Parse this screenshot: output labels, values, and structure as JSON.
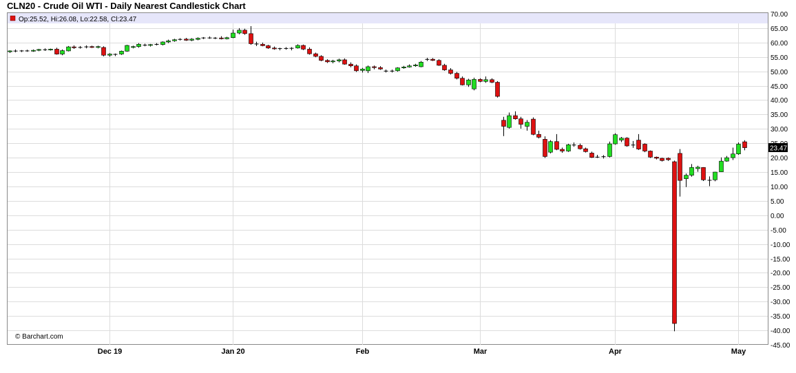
{
  "chart_title": "CLN20 - Crude Oil WTI - Daily Nearest Candlestick Chart",
  "legend": "Op:25.52, Hi:26.08, Lo:22.58, Cl:23.47",
  "credit": "© Barchart.com",
  "last_price_label": "23.47",
  "colors": {
    "up": "#22dd22",
    "down": "#dd1111",
    "legend_band": "#e6e6fa",
    "grid": "#dcdcdc",
    "last_label_bg": "#000000"
  },
  "chart_data": {
    "type": "candlestick",
    "title": "CLN20 - Crude Oil WTI - Daily Nearest Candlestick Chart",
    "y_range": [
      -45,
      70
    ],
    "y_ticks": [
      70,
      65,
      60,
      55,
      50,
      45,
      40,
      35,
      30,
      25,
      20,
      15,
      10,
      5,
      0,
      -5,
      -10,
      -15,
      -20,
      -25,
      -30,
      -35,
      -40,
      -45
    ],
    "y_tick_labels": [
      "70.00",
      "65.00",
      "60.00",
      "55.00",
      "50.00",
      "45.00",
      "40.00",
      "35.00",
      "30.00",
      "25.00",
      "20.00",
      "15.00",
      "10.00",
      "5.00",
      "0.00",
      "-5.00",
      "-10.00",
      "-15.00",
      "-20.00",
      "-25.00",
      "-30.00",
      "-35.00",
      "-40.00",
      "-45.00"
    ],
    "x_labels": [
      {
        "label": "Dec 19",
        "bar": 17
      },
      {
        "label": "Jan 20",
        "bar": 38
      },
      {
        "label": "Feb",
        "bar": 60
      },
      {
        "label": "Mar",
        "bar": 80
      },
      {
        "label": "Apr",
        "bar": 103
      },
      {
        "label": "May",
        "bar": 124
      }
    ],
    "grid": true,
    "ohlc": [
      [
        56.8,
        57.3,
        56.4,
        57.1
      ],
      [
        57.1,
        57.6,
        56.6,
        57.0
      ],
      [
        57.0,
        57.4,
        56.7,
        57.2
      ],
      [
        57.2,
        57.5,
        56.8,
        57.0
      ],
      [
        57.0,
        57.6,
        56.8,
        57.3
      ],
      [
        57.3,
        57.8,
        57.0,
        57.6
      ],
      [
        57.6,
        58.0,
        57.1,
        57.4
      ],
      [
        57.4,
        57.9,
        57.2,
        57.7
      ],
      [
        57.7,
        58.2,
        55.8,
        56.0
      ],
      [
        56.0,
        57.6,
        55.6,
        57.2
      ],
      [
        57.1,
        58.8,
        56.9,
        58.5
      ],
      [
        58.5,
        59.0,
        57.8,
        58.2
      ],
      [
        58.2,
        58.8,
        57.9,
        58.4
      ],
      [
        58.4,
        59.0,
        58.0,
        58.6
      ],
      [
        58.6,
        58.9,
        58.1,
        58.3
      ],
      [
        58.3,
        58.9,
        58.0,
        58.6
      ],
      [
        58.3,
        58.7,
        55.2,
        55.6
      ],
      [
        55.6,
        56.3,
        55.1,
        56.0
      ],
      [
        55.8,
        56.2,
        55.3,
        56.0
      ],
      [
        56.0,
        57.2,
        55.7,
        57.0
      ],
      [
        57.0,
        59.2,
        56.8,
        59.0
      ],
      [
        58.3,
        58.9,
        58.0,
        58.6
      ],
      [
        58.6,
        59.8,
        58.2,
        59.4
      ],
      [
        59.2,
        59.6,
        58.7,
        59.0
      ],
      [
        59.0,
        59.5,
        58.6,
        59.3
      ],
      [
        59.3,
        59.8,
        59.0,
        59.4
      ],
      [
        59.3,
        60.4,
        59.0,
        60.2
      ],
      [
        60.2,
        61.0,
        59.8,
        60.6
      ],
      [
        60.6,
        61.3,
        60.3,
        61.0
      ],
      [
        61.0,
        61.5,
        60.7,
        61.2
      ],
      [
        61.2,
        61.6,
        60.6,
        60.8
      ],
      [
        60.8,
        61.5,
        60.5,
        61.2
      ],
      [
        61.1,
        61.8,
        60.8,
        61.5
      ],
      [
        61.5,
        61.9,
        61.2,
        61.7
      ],
      [
        61.7,
        62.1,
        61.3,
        61.5
      ],
      [
        61.5,
        61.9,
        61.2,
        61.6
      ],
      [
        61.6,
        62.2,
        61.1,
        61.3
      ],
      [
        61.3,
        62.0,
        61.1,
        61.7
      ],
      [
        61.7,
        64.5,
        61.5,
        63.3
      ],
      [
        63.3,
        65.0,
        62.9,
        64.3
      ],
      [
        64.3,
        64.8,
        62.7,
        63.1
      ],
      [
        63.1,
        65.7,
        59.2,
        59.6
      ],
      [
        59.6,
        60.3,
        58.8,
        59.4
      ],
      [
        59.4,
        60.0,
        58.7,
        58.9
      ],
      [
        58.9,
        59.2,
        57.8,
        58.1
      ],
      [
        58.1,
        58.6,
        57.5,
        57.8
      ],
      [
        57.8,
        58.2,
        57.3,
        58.0
      ],
      [
        58.0,
        58.4,
        57.5,
        57.9
      ],
      [
        57.9,
        58.4,
        57.3,
        58.1
      ],
      [
        58.1,
        59.4,
        57.9,
        59.0
      ],
      [
        59.0,
        59.3,
        57.4,
        57.7
      ],
      [
        57.7,
        58.3,
        55.8,
        56.1
      ],
      [
        56.1,
        56.5,
        54.9,
        55.2
      ],
      [
        55.2,
        55.6,
        53.5,
        53.8
      ],
      [
        53.8,
        54.2,
        52.9,
        53.3
      ],
      [
        53.3,
        54.0,
        52.8,
        53.6
      ],
      [
        53.6,
        54.4,
        53.1,
        54.0
      ],
      [
        54.0,
        54.5,
        52.3,
        52.5
      ],
      [
        52.5,
        53.1,
        51.4,
        51.9
      ],
      [
        51.9,
        52.4,
        49.8,
        50.2
      ],
      [
        50.3,
        51.2,
        49.6,
        50.8
      ],
      [
        50.2,
        52.0,
        49.4,
        51.6
      ],
      [
        51.6,
        52.0,
        50.7,
        51.3
      ],
      [
        51.3,
        51.8,
        50.5,
        50.8
      ],
      [
        50.0,
        50.6,
        49.6,
        50.2
      ],
      [
        50.2,
        50.6,
        49.6,
        50.0
      ],
      [
        50.2,
        51.4,
        49.9,
        51.2
      ],
      [
        51.2,
        51.9,
        50.9,
        51.5
      ],
      [
        51.5,
        52.4,
        51.3,
        51.9
      ],
      [
        51.9,
        52.6,
        51.6,
        52.2
      ],
      [
        51.6,
        53.6,
        51.4,
        53.2
      ],
      [
        54.1,
        54.7,
        53.6,
        54.2
      ],
      [
        54.2,
        54.6,
        53.6,
        53.8
      ],
      [
        53.8,
        54.2,
        51.9,
        52.1
      ],
      [
        52.1,
        52.6,
        50.2,
        50.5
      ],
      [
        50.5,
        51.1,
        48.9,
        49.3
      ],
      [
        49.3,
        49.8,
        47.2,
        47.6
      ],
      [
        47.6,
        48.2,
        45.1,
        45.3
      ],
      [
        45.3,
        47.4,
        44.6,
        47.0
      ],
      [
        43.9,
        47.8,
        43.4,
        47.2
      ],
      [
        47.2,
        47.6,
        46.2,
        46.5
      ],
      [
        46.5,
        48.2,
        46.0,
        47.1
      ],
      [
        47.1,
        47.6,
        45.9,
        46.2
      ],
      [
        46.2,
        46.6,
        40.9,
        41.3
      ],
      [
        33.0,
        34.2,
        27.5,
        30.9
      ],
      [
        30.5,
        35.7,
        30.1,
        34.6
      ],
      [
        34.6,
        36.1,
        33.2,
        33.5
      ],
      [
        33.5,
        34.2,
        30.1,
        31.6
      ],
      [
        30.9,
        33.1,
        29.4,
        32.3
      ],
      [
        33.4,
        34.0,
        27.8,
        28.1
      ],
      [
        28.1,
        29.4,
        26.7,
        27.1
      ],
      [
        26.4,
        27.4,
        19.9,
        20.4
      ],
      [
        21.9,
        26.1,
        21.5,
        25.6
      ],
      [
        25.6,
        28.2,
        22.6,
        22.9
      ],
      [
        22.9,
        23.5,
        21.7,
        22.3
      ],
      [
        22.3,
        24.8,
        22.0,
        24.5
      ],
      [
        24.5,
        25.3,
        23.8,
        24.3
      ],
      [
        24.3,
        24.9,
        22.8,
        23.1
      ],
      [
        23.1,
        23.5,
        21.8,
        22.1
      ],
      [
        21.6,
        22.1,
        19.9,
        20.1
      ],
      [
        20.1,
        21.0,
        19.9,
        20.3
      ],
      [
        20.3,
        20.9,
        19.7,
        20.4
      ],
      [
        20.4,
        25.6,
        20.1,
        24.8
      ],
      [
        24.8,
        28.5,
        24.5,
        28.0
      ],
      [
        26.1,
        27.2,
        25.4,
        26.8
      ],
      [
        26.8,
        27.1,
        23.8,
        24.1
      ],
      [
        24.5,
        25.8,
        23.4,
        24.3
      ],
      [
        26.1,
        28.2,
        22.7,
        23.0
      ],
      [
        24.7,
        25.0,
        21.9,
        22.3
      ],
      [
        22.3,
        22.5,
        19.9,
        20.2
      ],
      [
        20.2,
        20.4,
        19.4,
        19.8
      ],
      [
        19.8,
        20.0,
        18.7,
        19.0
      ],
      [
        19.8,
        20.1,
        18.9,
        19.3
      ],
      [
        18.6,
        19.0,
        -40.3,
        -37.6
      ],
      [
        21.5,
        23.0,
        6.5,
        12.1
      ],
      [
        12.7,
        14.5,
        9.8,
        13.9
      ],
      [
        13.9,
        17.8,
        13.4,
        16.6
      ],
      [
        16.2,
        17.2,
        15.1,
        16.7
      ],
      [
        16.6,
        16.7,
        11.9,
        12.3
      ],
      [
        12.1,
        13.5,
        10.1,
        12.2
      ],
      [
        12.3,
        15.1,
        11.8,
        15.0
      ],
      [
        15.1,
        20.1,
        15.0,
        18.8
      ],
      [
        18.8,
        20.6,
        18.6,
        20.0
      ],
      [
        20.0,
        23.5,
        19.2,
        21.3
      ],
      [
        21.3,
        25.3,
        21.0,
        24.7
      ],
      [
        25.52,
        26.08,
        22.58,
        23.47
      ]
    ]
  }
}
